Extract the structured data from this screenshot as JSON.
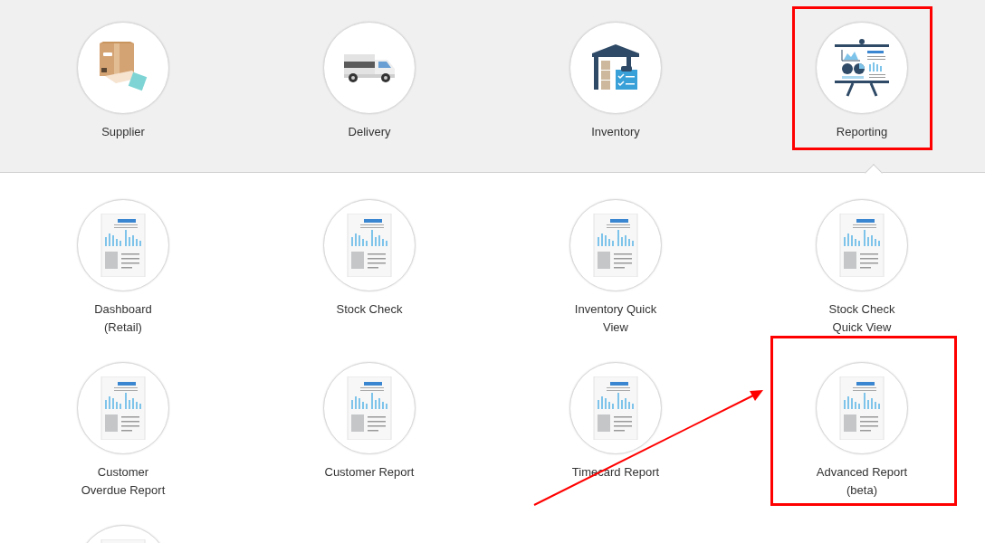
{
  "top_menu": [
    {
      "label": "Supplier",
      "selected": false,
      "highlighted": false
    },
    {
      "label": "Delivery",
      "selected": false,
      "highlighted": false
    },
    {
      "label": "Inventory",
      "selected": false,
      "highlighted": false
    },
    {
      "label": "Reporting",
      "selected": true,
      "highlighted": true
    }
  ],
  "reports": [
    {
      "kind": "tile",
      "label": "Dashboard\n(Retail)",
      "highlighted": false
    },
    {
      "kind": "tile",
      "label": "Stock Check",
      "highlighted": false
    },
    {
      "kind": "tile",
      "label": "Inventory Quick\nView",
      "highlighted": false
    },
    {
      "kind": "tile",
      "label": "Stock Check\nQuick View",
      "highlighted": false
    },
    {
      "kind": "tile",
      "label": "Customer\nOverdue Report",
      "highlighted": false
    },
    {
      "kind": "tile",
      "label": "Customer Report",
      "highlighted": false
    },
    {
      "kind": "tile",
      "label": "Timecard Report",
      "highlighted": false
    },
    {
      "kind": "tile",
      "label": "Advanced Report\n(beta)",
      "highlighted": true
    },
    {
      "kind": "partial"
    }
  ],
  "annotations": [
    {
      "kind": "arrow"
    }
  ]
}
